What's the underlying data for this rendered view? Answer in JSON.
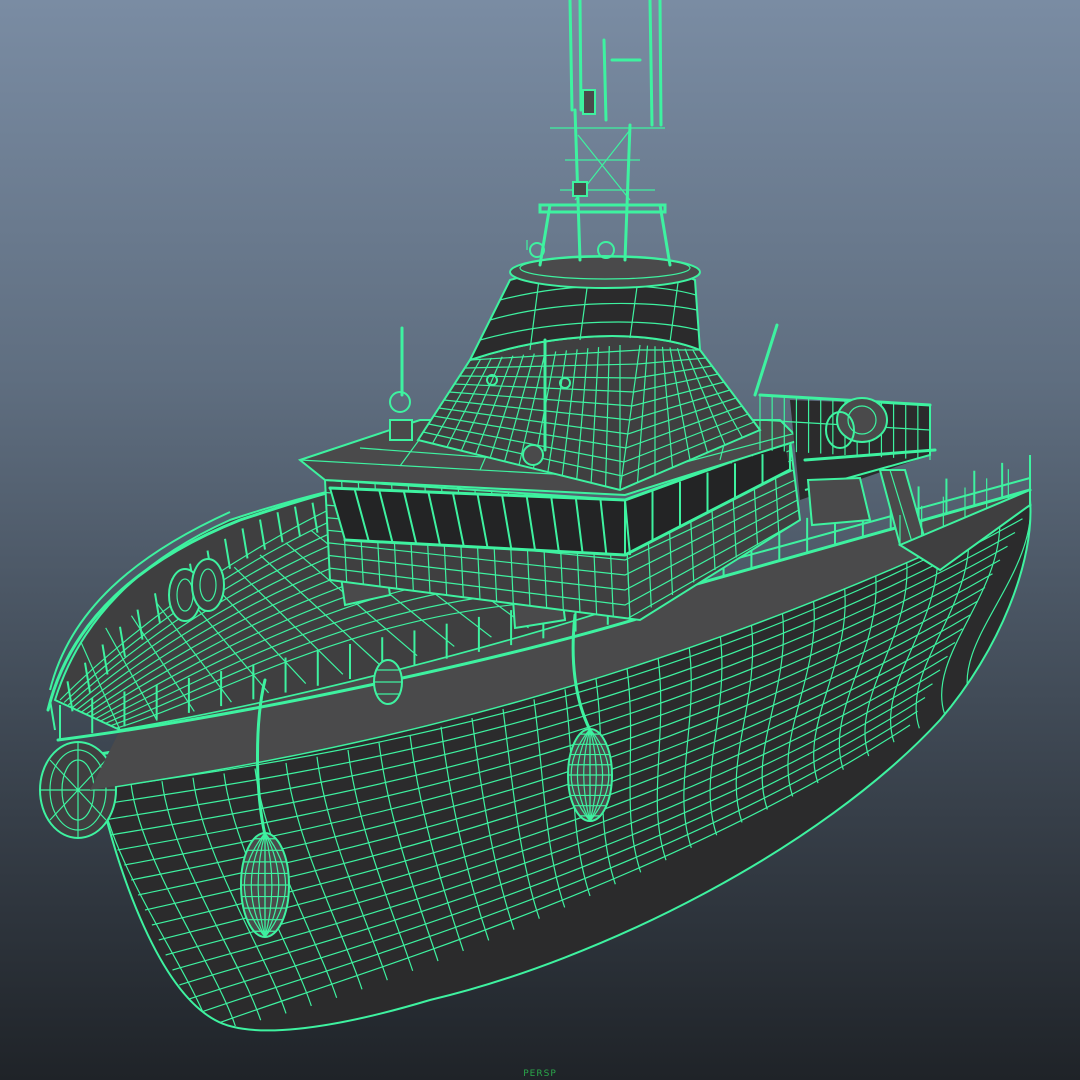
{
  "viewport": {
    "view_label": "PERSP"
  },
  "colors": {
    "wire": "#3ef2a0",
    "wire_dim": "#2fc987",
    "surface": "#3f3f40",
    "surface_dark": "#2b2b2c",
    "surface_light": "#4a4a4b",
    "glass": "#232425",
    "label": "#2aa84a"
  },
  "model": {
    "name": "boat-wireframe-icon"
  }
}
